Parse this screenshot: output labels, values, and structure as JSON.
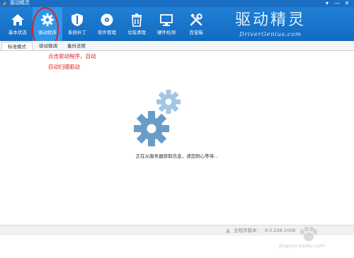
{
  "window": {
    "title": "驱动精灵",
    "controls": [
      "▾",
      "—",
      "✕"
    ]
  },
  "toolbar": {
    "items": [
      {
        "label": "基本状态",
        "icon": "home-icon"
      },
      {
        "label": "驱动程序",
        "icon": "gear-icon",
        "active": true
      },
      {
        "label": "系统补丁",
        "icon": "shield-icon"
      },
      {
        "label": "软件管理",
        "icon": "disc-icon"
      },
      {
        "label": "垃圾清理",
        "icon": "trash-icon"
      },
      {
        "label": "硬件检测",
        "icon": "monitor-icon"
      },
      {
        "label": "百宝箱",
        "icon": "tools-icon"
      }
    ],
    "brand_cn": "驱动精灵",
    "brand_en": "DriverGenius.com"
  },
  "tabs": [
    {
      "label": "标准模式",
      "active": true
    },
    {
      "label": "驱动微调",
      "active": false
    },
    {
      "label": "备份还原",
      "active": false
    }
  ],
  "annotation": {
    "line1": "点击驱动程序，自动",
    "line2": "自动扫描驱动"
  },
  "main": {
    "status_message": "正在从服务器获取信息，请您耐心等待..."
  },
  "footer": {
    "version_label": "主程序版本：",
    "version_value": "8.0.228.1006"
  },
  "watermark": {
    "text": "jingyan.baidu.com"
  },
  "colors": {
    "toolbar": "#1a72c9",
    "active_tab": "#2f96ea",
    "gear_large": "#6a9cc8",
    "gear_small": "#a3c6e4",
    "annotation": "#e02020"
  }
}
